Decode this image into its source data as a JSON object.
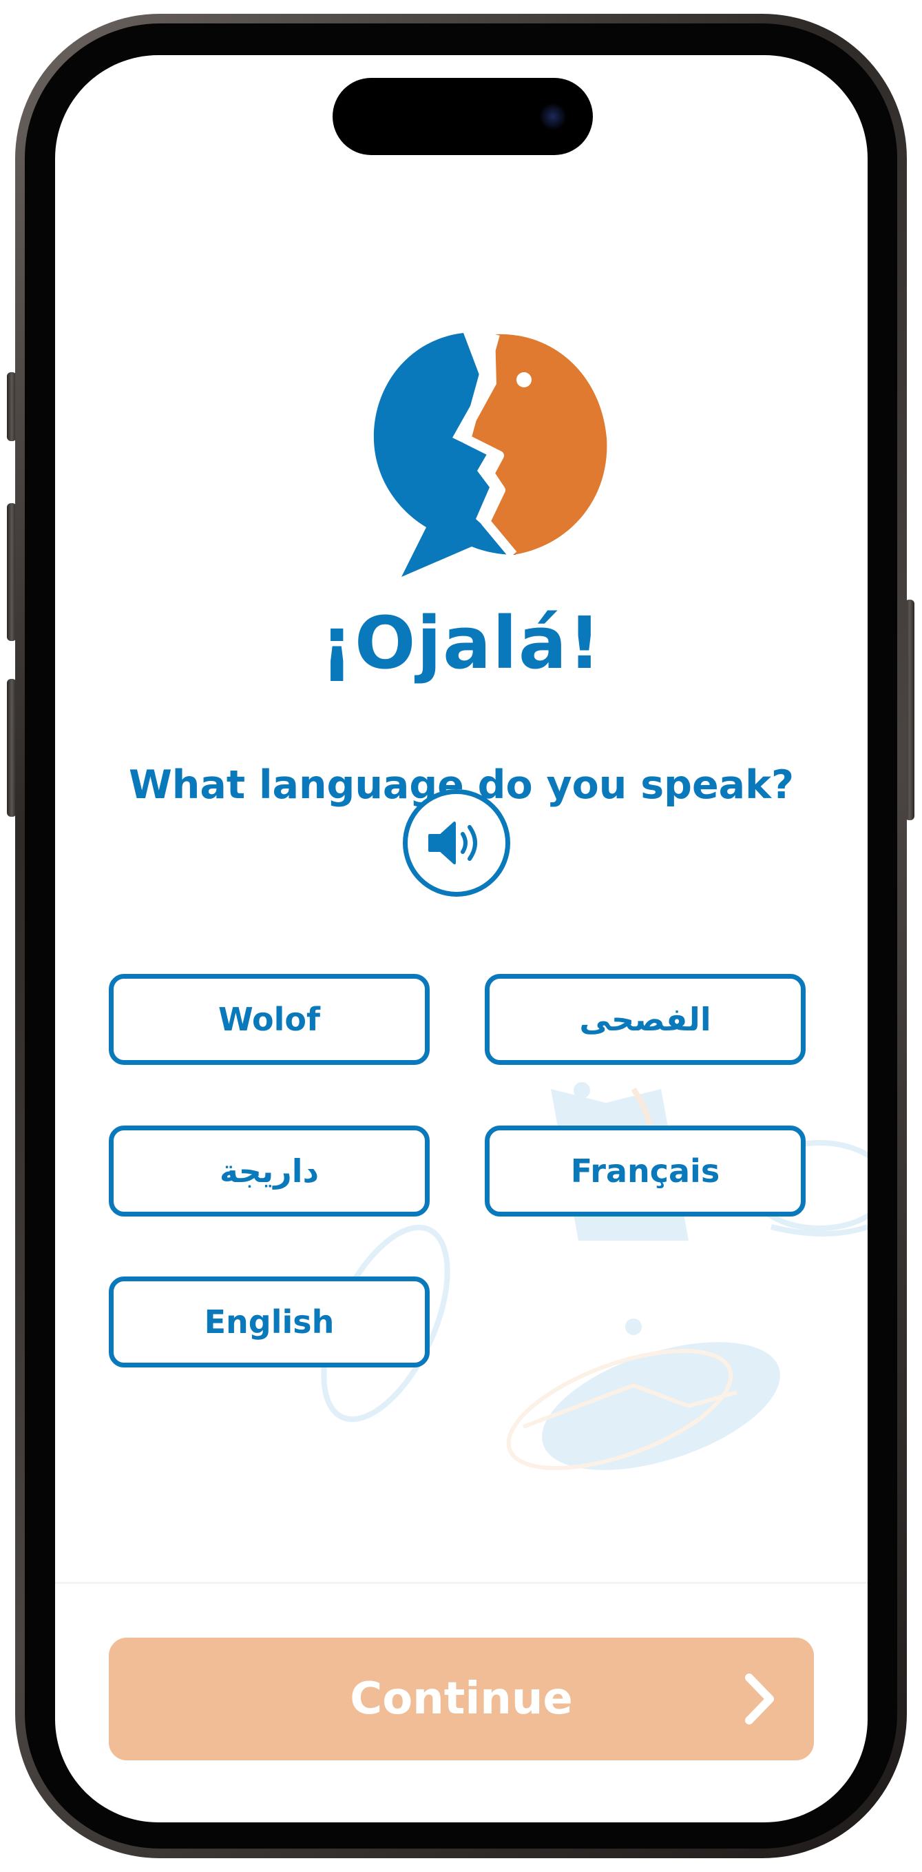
{
  "app": {
    "brand_name": "¡Ojalá!"
  },
  "onboarding": {
    "question": "What language do you speak?",
    "audio_icon": "speaker-icon",
    "languages": [
      {
        "label": "Wolof"
      },
      {
        "label": "الفصحى"
      },
      {
        "label": "داريجة"
      },
      {
        "label": "Français"
      },
      {
        "label": "English"
      }
    ],
    "continue_label": "Continue",
    "continue_icon": "chevron-right-icon"
  },
  "colors": {
    "brand_blue": "#0a79bb",
    "brand_orange": "#e07a30",
    "continue_disabled": "#f0bd97"
  }
}
